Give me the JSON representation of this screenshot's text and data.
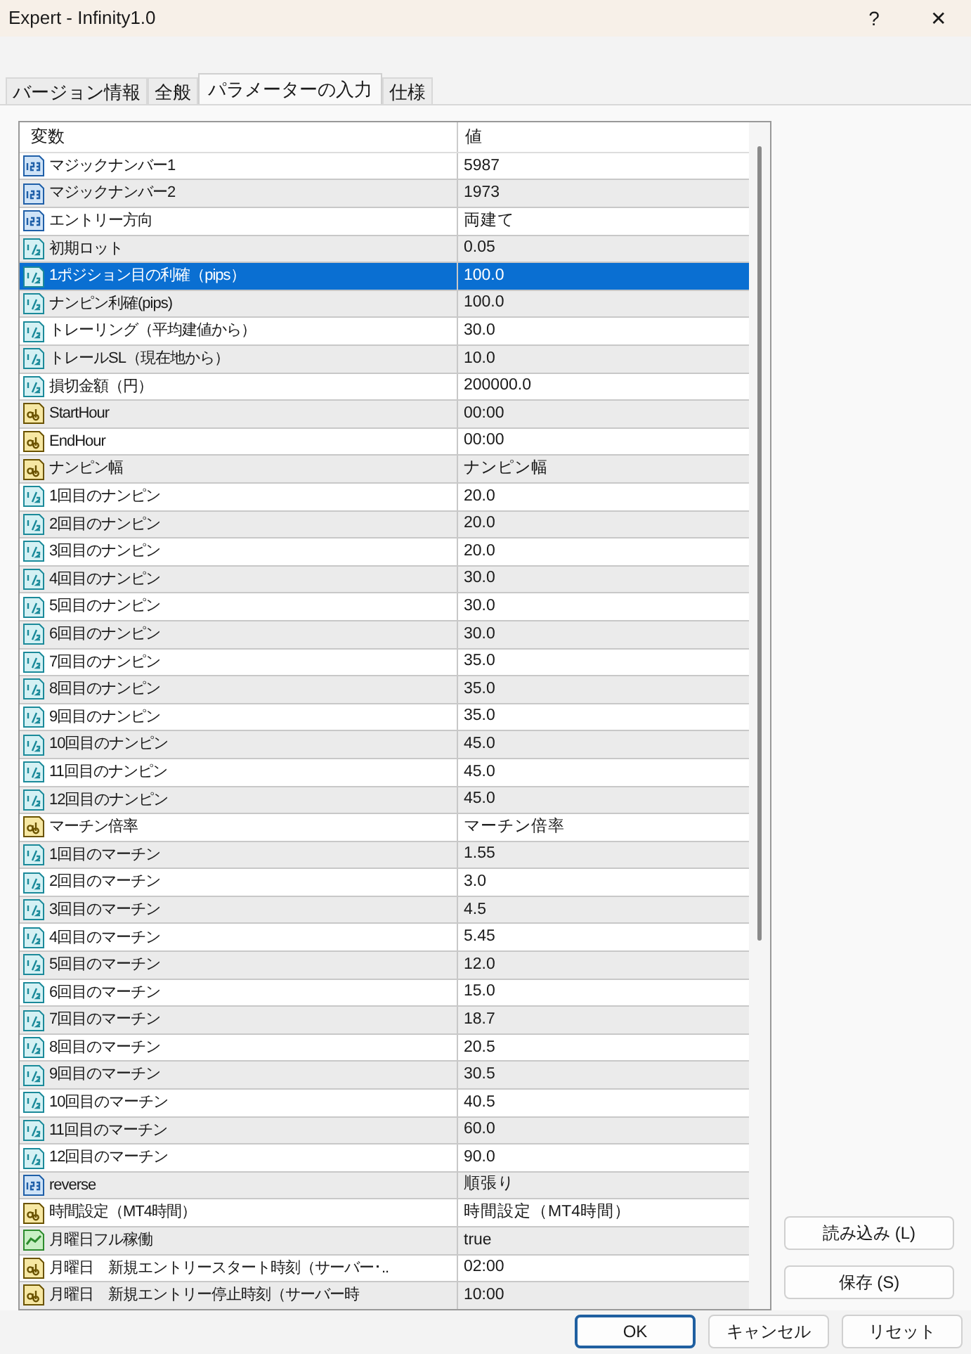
{
  "window": {
    "title": "Expert - Infinity1.0",
    "help": "?",
    "close": "✕"
  },
  "tabs": [
    {
      "label": "バージョン情報",
      "selected": false
    },
    {
      "label": "全般",
      "selected": false
    },
    {
      "label": "パラメーターの入力",
      "selected": true
    },
    {
      "label": "仕様",
      "selected": false
    }
  ],
  "table": {
    "columns": [
      "変数",
      "値"
    ],
    "rows": [
      {
        "kind": "int",
        "name": "マジックナンバー1",
        "value": "5987",
        "selected": false
      },
      {
        "kind": "int",
        "name": "マジックナンバー2",
        "value": "1973",
        "selected": false
      },
      {
        "kind": "int",
        "name": "エントリー方向",
        "value": "両建て",
        "selected": false
      },
      {
        "kind": "double",
        "name": "初期ロット",
        "value": "0.05",
        "selected": false
      },
      {
        "kind": "double",
        "name": "1ポジション目の利確（pips）",
        "value": "100.0",
        "selected": true
      },
      {
        "kind": "double",
        "name": "ナンピン利確(pips)",
        "value": "100.0",
        "selected": false
      },
      {
        "kind": "double",
        "name": "トレーリング（平均建値から）",
        "value": "30.0",
        "selected": false
      },
      {
        "kind": "double",
        "name": "トレールSL（現在地から）",
        "value": "10.0",
        "selected": false
      },
      {
        "kind": "double",
        "name": "損切金額（円）",
        "value": "200000.0",
        "selected": false
      },
      {
        "kind": "string",
        "name": "StartHour",
        "value": "00:00",
        "selected": false
      },
      {
        "kind": "string",
        "name": "EndHour",
        "value": "00:00",
        "selected": false
      },
      {
        "kind": "string",
        "name": "ナンピン幅",
        "value": "ナンピン幅",
        "selected": false
      },
      {
        "kind": "double",
        "name": "1回目のナンピン",
        "value": "20.0",
        "selected": false
      },
      {
        "kind": "double",
        "name": "2回目のナンピン",
        "value": "20.0",
        "selected": false
      },
      {
        "kind": "double",
        "name": "3回目のナンピン",
        "value": "20.0",
        "selected": false
      },
      {
        "kind": "double",
        "name": "4回目のナンピン",
        "value": "30.0",
        "selected": false
      },
      {
        "kind": "double",
        "name": "5回目のナンピン",
        "value": "30.0",
        "selected": false
      },
      {
        "kind": "double",
        "name": "6回目のナンピン",
        "value": "30.0",
        "selected": false
      },
      {
        "kind": "double",
        "name": "7回目のナンピン",
        "value": "35.0",
        "selected": false
      },
      {
        "kind": "double",
        "name": "8回目のナンピン",
        "value": "35.0",
        "selected": false
      },
      {
        "kind": "double",
        "name": "9回目のナンピン",
        "value": "35.0",
        "selected": false
      },
      {
        "kind": "double",
        "name": "10回目のナンピン",
        "value": "45.0",
        "selected": false
      },
      {
        "kind": "double",
        "name": "11回目のナンピン",
        "value": "45.0",
        "selected": false
      },
      {
        "kind": "double",
        "name": "12回目のナンピン",
        "value": "45.0",
        "selected": false
      },
      {
        "kind": "string",
        "name": "マーチン倍率",
        "value": "マーチン倍率",
        "selected": false
      },
      {
        "kind": "double",
        "name": "1回目のマーチン",
        "value": "1.55",
        "selected": false
      },
      {
        "kind": "double",
        "name": "2回目のマーチン",
        "value": "3.0",
        "selected": false
      },
      {
        "kind": "double",
        "name": "3回目のマーチン",
        "value": "4.5",
        "selected": false
      },
      {
        "kind": "double",
        "name": "4回目のマーチン",
        "value": "5.45",
        "selected": false
      },
      {
        "kind": "double",
        "name": "5回目のマーチン",
        "value": "12.0",
        "selected": false
      },
      {
        "kind": "double",
        "name": "6回目のマーチン",
        "value": "15.0",
        "selected": false
      },
      {
        "kind": "double",
        "name": "7回目のマーチン",
        "value": "18.7",
        "selected": false
      },
      {
        "kind": "double",
        "name": "8回目のマーチン",
        "value": "20.5",
        "selected": false
      },
      {
        "kind": "double",
        "name": "9回目のマーチン",
        "value": "30.5",
        "selected": false
      },
      {
        "kind": "double",
        "name": "10回目のマーチン",
        "value": "40.5",
        "selected": false
      },
      {
        "kind": "double",
        "name": "11回目のマーチン",
        "value": "60.0",
        "selected": false
      },
      {
        "kind": "double",
        "name": "12回目のマーチン",
        "value": "90.0",
        "selected": false
      },
      {
        "kind": "int",
        "name": "reverse",
        "value": "順張り",
        "selected": false
      },
      {
        "kind": "string",
        "name": "時間設定（MT4時間）",
        "value": "時間設定（MT4時間）",
        "selected": false
      },
      {
        "kind": "bool",
        "name": "月曜日フル稼働",
        "value": "true",
        "selected": false
      },
      {
        "kind": "string",
        "name": "月曜日　新規エントリースタート時刻（サーバー･..",
        "value": "02:00",
        "selected": false
      },
      {
        "kind": "string",
        "name": "月曜日　新規エントリー停止時刻（サーバー時",
        "value": "10:00",
        "selected": false
      }
    ]
  },
  "side_buttons": [
    "読み込み (L)",
    "保存 (S)"
  ],
  "footer_buttons": [
    {
      "label": "OK",
      "default": true
    },
    {
      "label": "キャンセル",
      "default": false
    },
    {
      "label": "リセット",
      "default": false
    }
  ]
}
